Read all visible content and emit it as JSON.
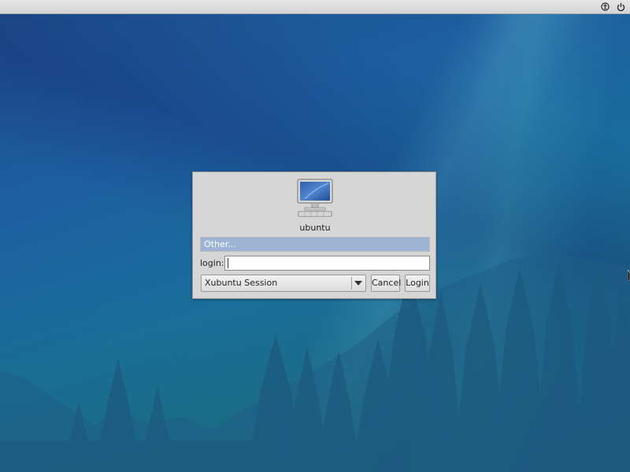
{
  "panel": {
    "icons": [
      "accessibility-icon",
      "power-icon"
    ]
  },
  "greeter": {
    "hostname": "ubuntu",
    "user_list": [
      {
        "label": "Other...",
        "selected": true
      }
    ],
    "login_label": "login:",
    "login_value": "",
    "session": {
      "selected": "Xubuntu Session"
    },
    "buttons": {
      "cancel": "Cancel",
      "login": "Login"
    }
  },
  "colors": {
    "panel_bg": "#dcdcdc",
    "dialog_bg": "#d6d6d6",
    "selection": "#9db4d4",
    "desktop_blue": "#1d5fa0",
    "desktop_teal": "#1a6e9c"
  }
}
